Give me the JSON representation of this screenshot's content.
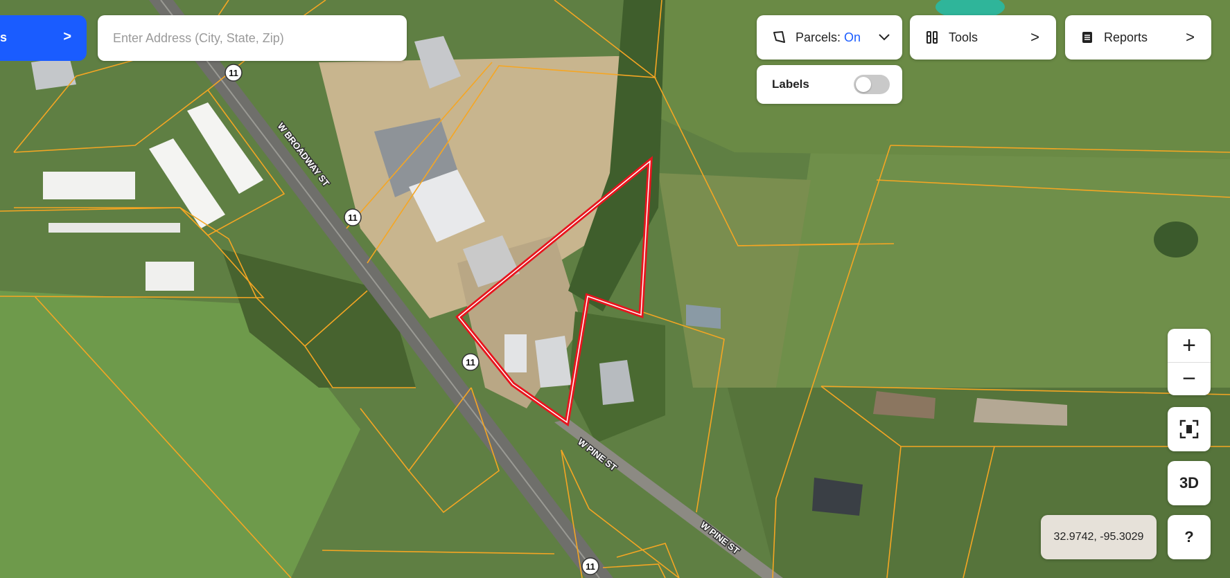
{
  "search": {
    "placeholder": "Enter Address (City, State, Zip)"
  },
  "left_button": {
    "label": "s",
    "chevron": ">"
  },
  "parcels": {
    "label": "Parcels:",
    "state": "On",
    "chevron": "chevron-down-icon"
  },
  "tools": {
    "label": "Tools",
    "chevron": ">"
  },
  "reports": {
    "label": "Reports",
    "chevron": ">"
  },
  "labels_toggle": {
    "label": "Labels",
    "on": false
  },
  "controls": {
    "zoom_in": "+",
    "zoom_out": "−",
    "three_d": "3D",
    "help": "?"
  },
  "coordinates": "32.9742, -95.3029",
  "map": {
    "roads": [
      "W BROADWAY ST",
      "W PINE ST",
      "W PINE ST"
    ],
    "route_shields": [
      "11",
      "11",
      "11",
      "11"
    ],
    "colors": {
      "parcel_line": "#f5a623",
      "selected_parcel": "#e8141d",
      "accent": "#1a5cff"
    }
  }
}
